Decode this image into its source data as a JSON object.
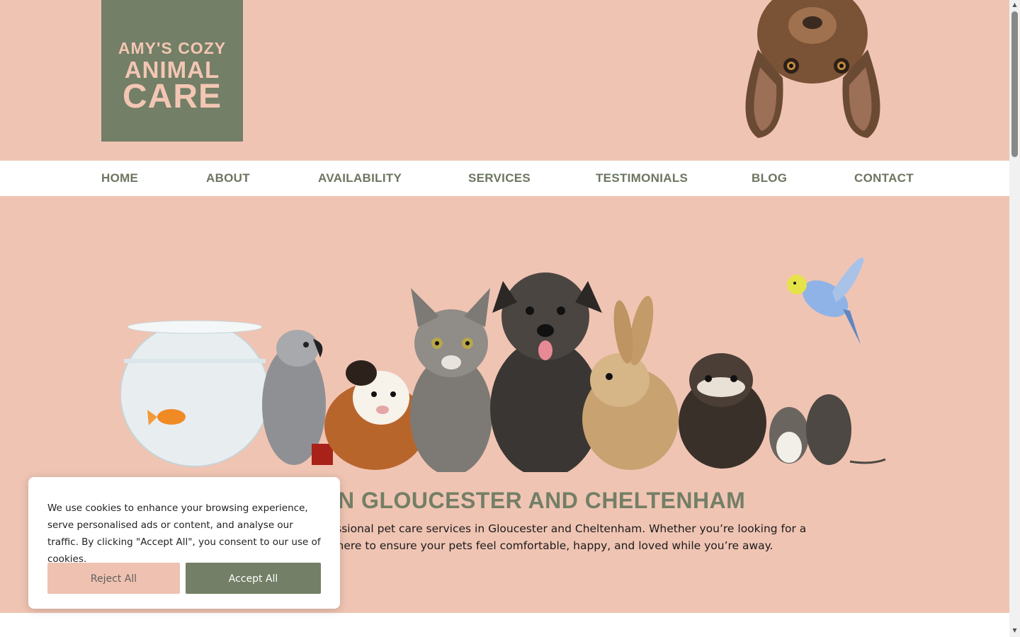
{
  "brand": {
    "logo_line1": "AMY'S COZY",
    "logo_line2": "ANIMAL",
    "logo_line3": "CARE"
  },
  "nav": {
    "items": [
      {
        "label": "HOME"
      },
      {
        "label": "ABOUT"
      },
      {
        "label": "AVAILABILITY"
      },
      {
        "label": "SERVICES"
      },
      {
        "label": "TESTIMONIALS"
      },
      {
        "label": "BLOG"
      },
      {
        "label": "CONTACT"
      }
    ]
  },
  "hero": {
    "title": "PETS IN GLOUCESTER AND CHELTENHAM",
    "text_line1": "trusted choice for professional pet care services in Gloucester and Cheltenham. Whether you’re looking for a",
    "text_line2": "dly cat sitter, I’m here to ensure your pets feel comfortable, happy, and loved while you’re away."
  },
  "cookie": {
    "message": "We use cookies to enhance your browsing experience, serve personalised ads or content, and analyse our traffic. By clicking \"Accept All\", you consent to our use of cookies.",
    "reject_label": "Reject All",
    "accept_label": "Accept All"
  },
  "colors": {
    "peach": "#f0c4b3",
    "sage": "#737f66",
    "nav_text": "#6c7560"
  }
}
